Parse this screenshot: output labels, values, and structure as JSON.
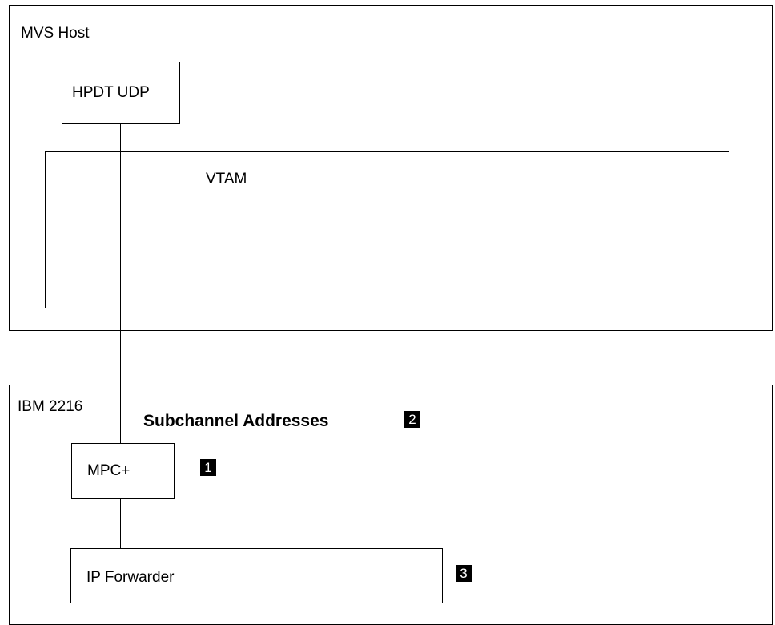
{
  "mvs_host": {
    "title": "MVS Host",
    "hpdt_udp": "HPDT UDP",
    "vtam": "VTAM"
  },
  "ibm_2216": {
    "title": "IBM 2216",
    "subchannel_label": "Subchannel Addresses",
    "subchannel_marker": "2",
    "mpc_plus": "MPC+",
    "mpc_marker": "1",
    "ip_forwarder": "IP Forwarder",
    "ip_forwarder_marker": "3"
  }
}
